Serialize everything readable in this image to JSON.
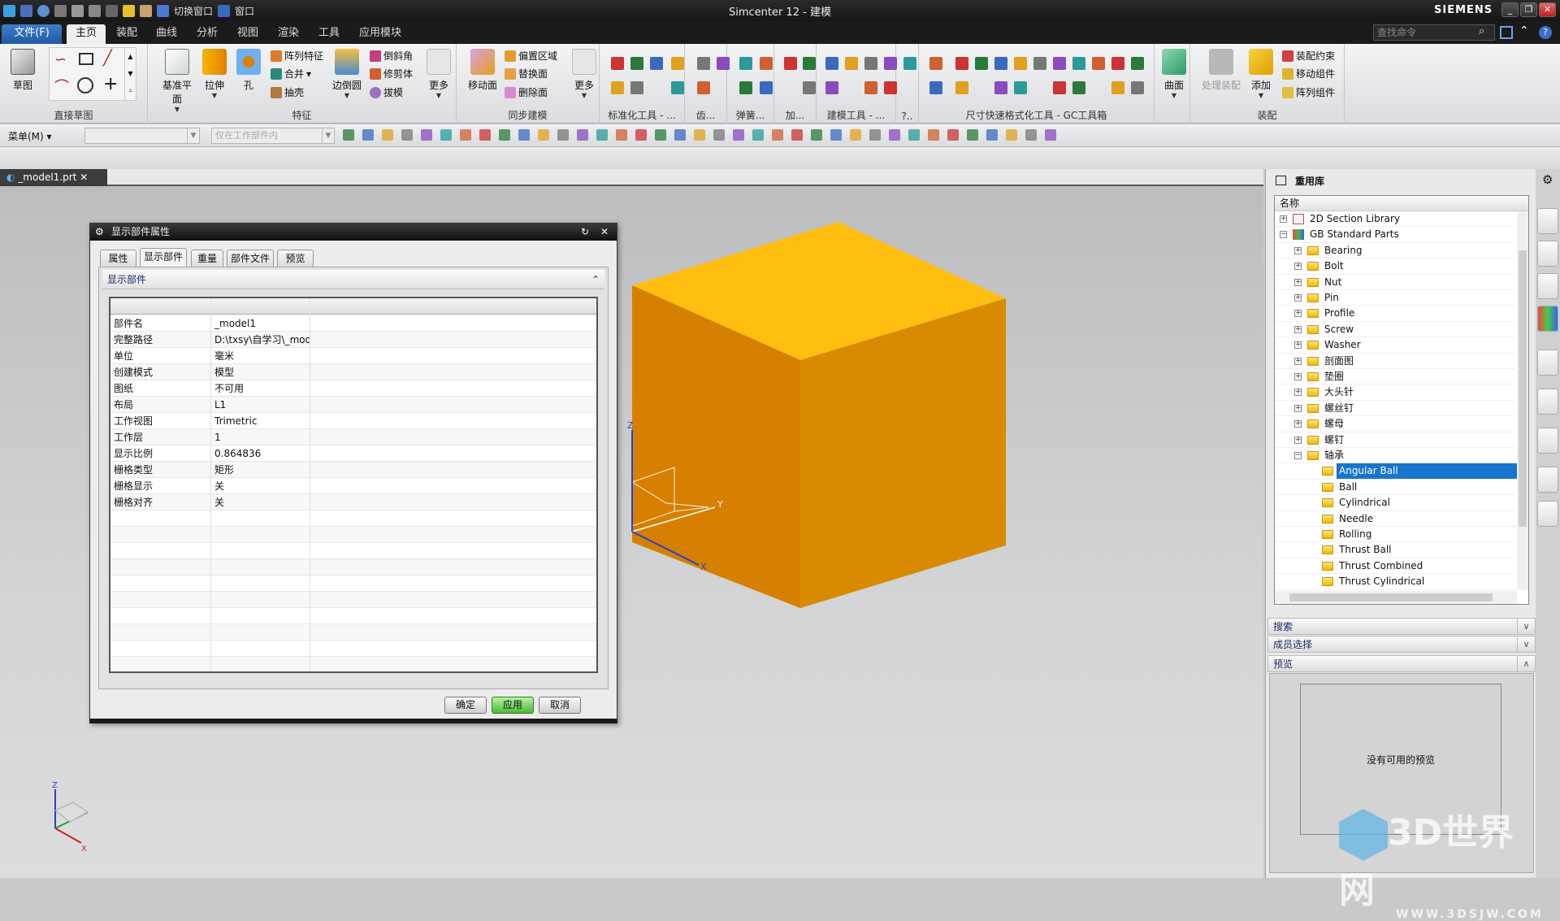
{
  "window": {
    "title": "Simcenter 12 - 建模",
    "brand": "SIEMENS",
    "qat_switch_window": "切换窗口",
    "qat_window": "窗口"
  },
  "menu_tabs": [
    {
      "label": "文件(F)"
    },
    {
      "label": "主页"
    },
    {
      "label": "装配"
    },
    {
      "label": "曲线"
    },
    {
      "label": "分析"
    },
    {
      "label": "视图"
    },
    {
      "label": "渲染"
    },
    {
      "label": "工具"
    },
    {
      "label": "应用模块"
    }
  ],
  "search": {
    "placeholder": "查找命令"
  },
  "ribbon": {
    "groups": [
      "直接草图",
      "特征",
      "同步建模",
      "标准化工具 - ...",
      "齿...",
      "弹簧...",
      "加...",
      "建模工具 - ...",
      "?..",
      "尺寸快速格式化工具 - GC工具箱",
      "",
      "装配"
    ],
    "big": [
      "草图",
      "基准平面",
      "拉伸",
      "孔",
      "边倒圆",
      "更多",
      "移动面",
      "更多",
      "曲面",
      "处理装配",
      "添加"
    ],
    "small": [
      "阵列特征",
      "合并",
      "抽壳",
      "倒斜角",
      "修剪体",
      "拔模",
      "偏置区域",
      "替换面",
      "删除面",
      "装配约束",
      "移动组件",
      "阵列组件"
    ]
  },
  "toolbar": {
    "menu_label": "菜单(M)",
    "filter_value": "",
    "scope_value": "仅在工作部件内"
  },
  "doc_tab": {
    "label": "_model1.prt"
  },
  "dialog": {
    "title": "显示部件属性",
    "tabs": [
      {
        "label": "属性"
      },
      {
        "label": "显示部件"
      },
      {
        "label": "重量"
      },
      {
        "label": "部件文件"
      },
      {
        "label": "预览"
      }
    ],
    "active_tab": 1,
    "section": "显示部件",
    "rows": [
      {
        "k": "部件名",
        "v": "_model1"
      },
      {
        "k": "完整路径",
        "v": "D:\\txsy\\自学习\\_model..."
      },
      {
        "k": "单位",
        "v": "毫米"
      },
      {
        "k": "创建模式",
        "v": "模型"
      },
      {
        "k": "图纸",
        "v": "不可用"
      },
      {
        "k": "布局",
        "v": "L1"
      },
      {
        "k": "工作视图",
        "v": "Trimetric"
      },
      {
        "k": "工作层",
        "v": "1"
      },
      {
        "k": "显示比例",
        "v": "0.864836"
      },
      {
        "k": "栅格类型",
        "v": "矩形"
      },
      {
        "k": "栅格显示",
        "v": "关"
      },
      {
        "k": "栅格对齐",
        "v": "关"
      }
    ],
    "buttons": {
      "ok": "确定",
      "apply": "应用",
      "cancel": "取消"
    }
  },
  "reuse_library": {
    "title": "重用库",
    "column": "名称",
    "tree": [
      {
        "label": "2D Section Library",
        "level": 0,
        "state": "collapsed",
        "icon": "library-icon"
      },
      {
        "label": "GB Standard Parts",
        "level": 0,
        "state": "expanded",
        "icon": "books-icon"
      },
      {
        "label": "Bearing",
        "level": 1,
        "state": "collapsed",
        "icon": "folder-icon"
      },
      {
        "label": "Bolt",
        "level": 1,
        "state": "collapsed",
        "icon": "folder-icon"
      },
      {
        "label": "Nut",
        "level": 1,
        "state": "collapsed",
        "icon": "folder-icon"
      },
      {
        "label": "Pin",
        "level": 1,
        "state": "collapsed",
        "icon": "folder-icon"
      },
      {
        "label": "Profile",
        "level": 1,
        "state": "collapsed",
        "icon": "folder-icon"
      },
      {
        "label": "Screw",
        "level": 1,
        "state": "collapsed",
        "icon": "folder-icon"
      },
      {
        "label": "Washer",
        "level": 1,
        "state": "collapsed",
        "icon": "folder-icon"
      },
      {
        "label": "剖面图",
        "level": 1,
        "state": "collapsed",
        "icon": "folder-icon"
      },
      {
        "label": "垫圈",
        "level": 1,
        "state": "collapsed",
        "icon": "folder-icon"
      },
      {
        "label": "大头针",
        "level": 1,
        "state": "collapsed",
        "icon": "folder-icon"
      },
      {
        "label": "螺丝钉",
        "level": 1,
        "state": "collapsed",
        "icon": "folder-icon"
      },
      {
        "label": "螺母",
        "level": 1,
        "state": "collapsed",
        "icon": "folder-icon"
      },
      {
        "label": "螺钉",
        "level": 1,
        "state": "collapsed",
        "icon": "folder-icon"
      },
      {
        "label": "轴承",
        "level": 1,
        "state": "expanded",
        "icon": "folder-icon"
      },
      {
        "label": "Angular Ball",
        "level": 2,
        "state": "leaf",
        "icon": "folder-icon",
        "selected": true
      },
      {
        "label": "Ball",
        "level": 2,
        "state": "leaf",
        "icon": "folder-icon"
      },
      {
        "label": "Cylindrical",
        "level": 2,
        "state": "leaf",
        "icon": "folder-icon"
      },
      {
        "label": "Needle",
        "level": 2,
        "state": "leaf",
        "icon": "folder-icon"
      },
      {
        "label": "Rolling",
        "level": 2,
        "state": "leaf",
        "icon": "folder-icon"
      },
      {
        "label": "Thrust Ball",
        "level": 2,
        "state": "leaf",
        "icon": "folder-icon"
      },
      {
        "label": "Thrust Combined",
        "level": 2,
        "state": "leaf",
        "icon": "folder-icon"
      },
      {
        "label": "Thrust Cylindrical",
        "level": 2,
        "state": "leaf",
        "icon": "folder-icon"
      }
    ],
    "sections": {
      "search": "搜索",
      "member_select": "成员选择",
      "preview": "预览"
    },
    "preview_text": "没有可用的预览"
  },
  "viewport": {
    "axis_x": "X",
    "axis_y": "Y",
    "axis_z": "Z",
    "cube_colors": {
      "top": "#ffbe10",
      "left": "#d67f00",
      "right": "#d88a00"
    }
  },
  "watermark": {
    "text": "3D世界网",
    "url_text": "WWW.3DSJW.COM"
  },
  "colors": {
    "selection": "#1874cd",
    "file_tab": "#2e6db8",
    "apply_button": "#5cc44a"
  }
}
